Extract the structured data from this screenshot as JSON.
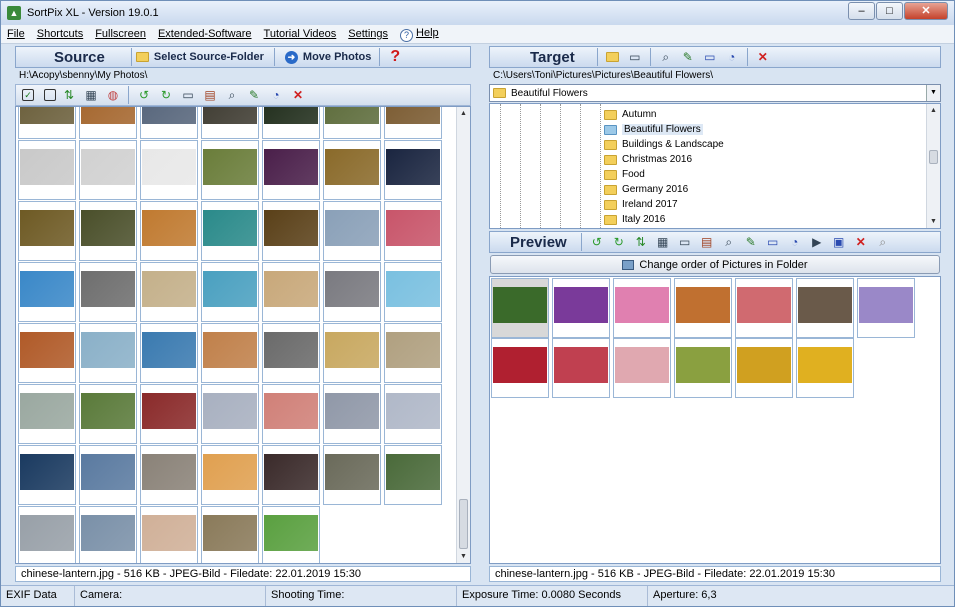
{
  "window": {
    "title": "SortPix XL - Version 19.0.1",
    "btn_min": "–",
    "btn_max": "□",
    "btn_close": "✕"
  },
  "menu": [
    {
      "label": "File"
    },
    {
      "label": "Shortcuts"
    },
    {
      "label": "Fullscreen"
    },
    {
      "label": "Extended-Software"
    },
    {
      "label": "Tutorial Videos"
    },
    {
      "label": "Settings"
    },
    {
      "label": "Help"
    }
  ],
  "source": {
    "title": "Source",
    "select_folder": "Select Source-Folder",
    "move_photos": "Move Photos",
    "path": "H:\\Acopy\\sbenny\\My Photos\\",
    "status": "chinese-lantern.jpg - 516 KB - JPEG-Bild - Filedate: 22.01.2019 15:30",
    "thumb_colors": [
      [
        "#6a5e3a",
        "#a4652c",
        "#55647a",
        "#3d3a30",
        "#1f2c1a",
        "#5c6b3a",
        "#7a5a30"
      ],
      [
        "#c9c9c9",
        "#d1d1d1",
        "#e8e8e8",
        "#6a7d3a",
        "#4a1f4a",
        "#8a6a2a",
        "#1a2540"
      ],
      [
        "#6e5a24",
        "#4a4f2a",
        "#c07a30",
        "#2a8a8a",
        "#5a4018",
        "#8aa0b8",
        "#c8556a"
      ],
      [
        "#3a88c8",
        "#6e6e6e",
        "#c4b08a",
        "#4aa0c0",
        "#c8a87a",
        "#7a7a80",
        "#7ac0e0"
      ],
      [
        "#b05a28",
        "#8ab0c8",
        "#3a7ab0",
        "#c0804a",
        "#6a6a6a",
        "#c8a860",
        "#b0a080"
      ],
      [
        "#9aa8a0",
        "#5a7a3a",
        "#8a2a2a",
        "#a8b0c0",
        "#d08078",
        "#9098a8",
        "#b0b8c8"
      ],
      [
        "#1a3a60",
        "#5a7aa0",
        "#8a8278",
        "#e0a050",
        "#3a2a2a",
        "#6a6a5a",
        "#4a6a3a"
      ],
      [
        "#98a0a8",
        "#7a90a8",
        "#d0b098",
        "#8a7a5a",
        "#5aa040"
      ]
    ]
  },
  "target": {
    "title": "Target",
    "path": "C:\\Users\\Toni\\Pictures\\Pictures\\Beautiful Flowers\\",
    "combo_value": "Beautiful Flowers",
    "tree": [
      "Autumn",
      "Beautiful Flowers",
      "Buildings & Landscape",
      "Christmas 2016",
      "Food",
      "Germany 2016",
      "Ireland 2017",
      "Italy 2016"
    ],
    "tree_selected": 1
  },
  "preview": {
    "title": "Preview",
    "change_order": "Change order of Pictures in Folder",
    "status": "chinese-lantern.jpg - 516 KB - JPEG-Bild - Filedate: 22.01.2019 15:30",
    "thumb_colors": [
      [
        "#3a6a2a",
        "#7a3a9a",
        "#e080b0",
        "#c07030",
        "#d06a70",
        "#6a5a4a",
        "#9a88c8"
      ],
      [
        "#b02030",
        "#c04050",
        "#e0a8b0",
        "#8aa040",
        "#d0a020",
        "#e0b020"
      ]
    ]
  },
  "status": {
    "exif": "EXIF Data",
    "camera": "Camera:",
    "shooting": "Shooting Time:",
    "exposure": "Exposure Time: 0.0080 Seconds",
    "aperture": "Aperture: 6,3"
  },
  "colors": {
    "accent": "#2a5aa0",
    "close_red": "#c8282a"
  }
}
